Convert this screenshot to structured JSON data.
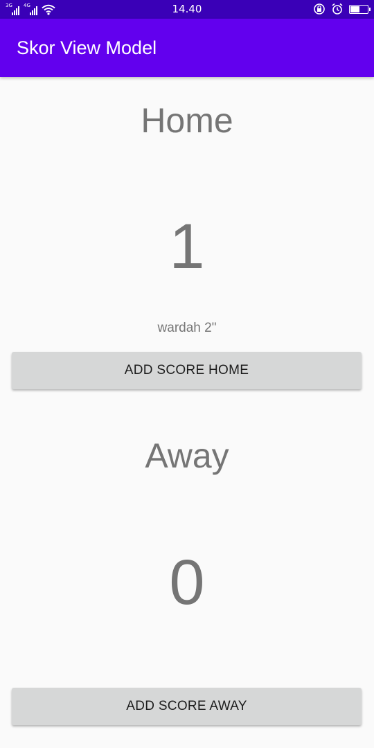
{
  "status_bar": {
    "network_1": "3G",
    "network_2": "4G",
    "time": "14.40",
    "icons": [
      "signal-icon",
      "wifi-icon",
      "rotation-lock-icon",
      "alarm-icon",
      "battery-icon"
    ],
    "battery_level": 0.55
  },
  "app_bar": {
    "title": "Skor View Model",
    "color": "#6200ee"
  },
  "home": {
    "label": "Home",
    "score": "1",
    "caption": "wardah 2\"",
    "button_label": "ADD SCORE HOME"
  },
  "away": {
    "label": "Away",
    "score": "0",
    "button_label": "ADD SCORE AWAY"
  }
}
